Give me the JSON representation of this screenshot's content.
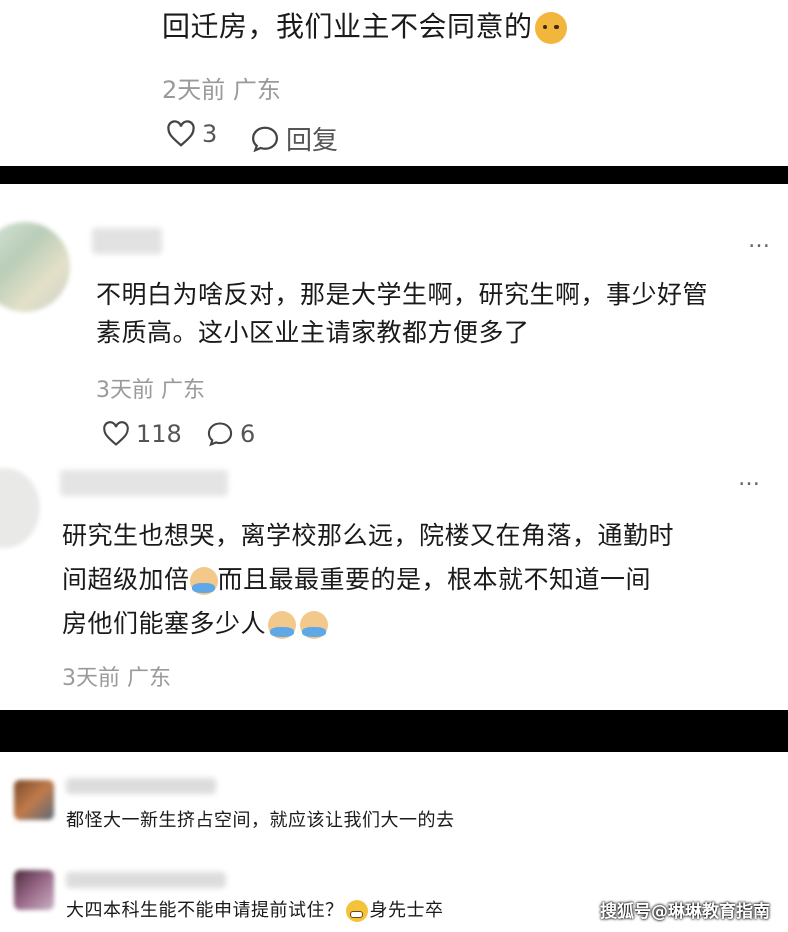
{
  "comments": [
    {
      "text": "回迁房，我们业主不会同意的",
      "emoji": "smug-face-emoji",
      "time": "2天前",
      "location": "广东",
      "likes": "3",
      "reply_label": "回复"
    },
    {
      "text_line1": "不明白为啥反对，那是大学生啊，研究生啊，事少好管",
      "text_line2": "素质高。这小区业主请家教都方便多了",
      "time": "3天前",
      "location": "广东",
      "likes": "118",
      "replies": "6"
    },
    {
      "text_line1": "研究生也想哭，离学校那么远，院楼又在角落，通勤时",
      "text_line2a": "间超级加倍",
      "text_line2b": "而且最最重要的是，根本就不知道一间",
      "text_line3": "房他们能塞多少人",
      "emoji": "crying-emoji",
      "time": "3天前",
      "location": "广东"
    },
    {
      "text": "都怪大一新生挤占空间，就应该让我们大一的去"
    },
    {
      "text_a": "大四本科生能不能申请提前试住？",
      "text_b": "身先士卒",
      "emoji": "grin-emoji"
    }
  ],
  "watermark": "搜狐号@琳琳教育指南",
  "more_icon": "…",
  "colors": {
    "separator": "#000000",
    "meta": "#9a9a9a"
  }
}
